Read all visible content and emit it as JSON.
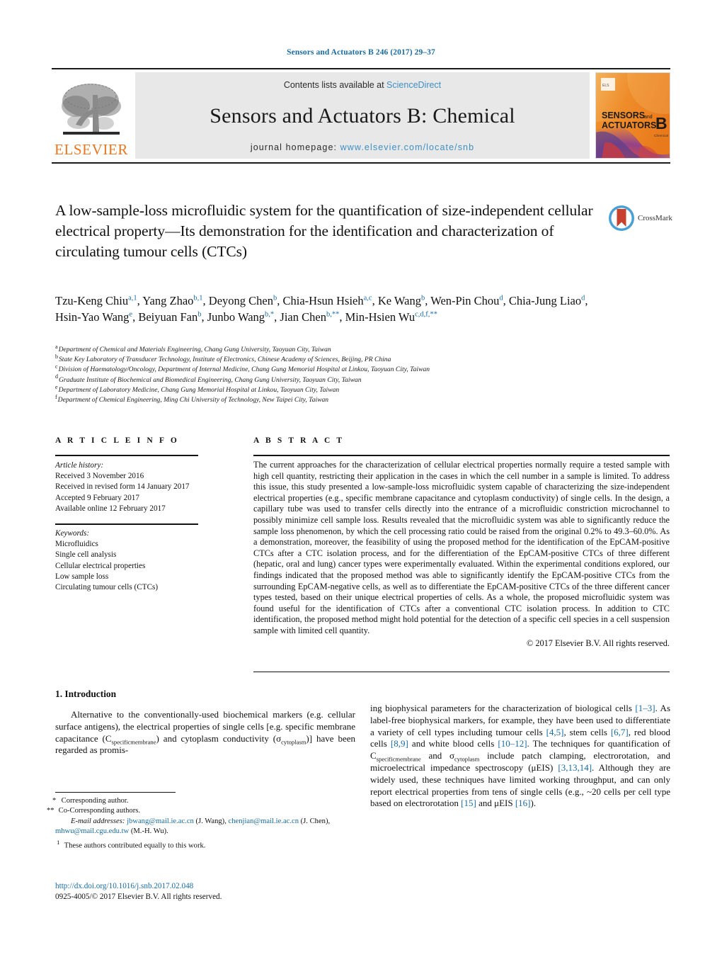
{
  "running_head": "Sensors and Actuators B 246 (2017) 29–37",
  "masthead": {
    "contents_prefix": "Contents lists available at ",
    "sciencedirect": "ScienceDirect",
    "journal_title": "Sensors and Actuators B: Chemical",
    "homepage_prefix": "journal homepage: ",
    "homepage_url": "www.elsevier.com/locate/snb",
    "publisher_wordmark": "ELSEVIER",
    "cover_line1": "SENSORS",
    "cover_and": "and",
    "cover_line2": "ACTUATORS",
    "cover_letter": "B",
    "cover_sub": "Chemical"
  },
  "crossmark": {
    "label": "CrossMark"
  },
  "title": {
    "line1": "A low-sample-loss microfluidic system for the quantification of",
    "line2": "size-independent cellular electrical property—Its demonstration for",
    "line3": "the identification and characterization of circulating tumour cells",
    "line4": "(CTCs)"
  },
  "authors": [
    {
      "name": "Tzu-Keng Chiu",
      "sup": "a,1",
      "sep": ", "
    },
    {
      "name": "Yang Zhao",
      "sup": "b,1",
      "sep": ", "
    },
    {
      "name": "Deyong Chen",
      "sup": "b",
      "sep": ", "
    },
    {
      "name": "Chia-Hsun Hsieh",
      "sup": "a,c",
      "sep": ", "
    },
    {
      "name": "Ke Wang",
      "sup": "b",
      "sep": ", "
    },
    {
      "name": "Wen-Pin Chou",
      "sup": "d",
      "sep": ", "
    },
    {
      "name": "Chia-Jung Liao",
      "sup": "d",
      "sep": ", "
    },
    {
      "name": "Hsin-Yao Wang",
      "sup": "e",
      "sep": ", "
    },
    {
      "name": "Beiyuan Fan",
      "sup": "b",
      "sep": ", "
    },
    {
      "name": "Junbo Wang",
      "sup": "b,*",
      "sep": ", "
    },
    {
      "name": "Jian Chen",
      "sup": "b,**",
      "sep": ", "
    },
    {
      "name": "Min-Hsien Wu",
      "sup": "c,d,f,**",
      "sep": ""
    }
  ],
  "affiliations": [
    {
      "mark": "a",
      "text": "Department of Chemical and Materials Engineering, Chang Gung University, Taoyuan City, Taiwan"
    },
    {
      "mark": "b",
      "text": "State Key Laboratory of Transducer Technology, Institute of Electronics, Chinese Academy of Sciences, Beijing, PR China"
    },
    {
      "mark": "c",
      "text": "Division of Haematology/Oncology, Department of Internal Medicine, Chang Gung Memorial Hospital at Linkou, Taoyuan City, Taiwan"
    },
    {
      "mark": "d",
      "text": "Graduate Institute of Biochemical and Biomedical Engineering, Chang Gung University, Taoyuan City, Taiwan"
    },
    {
      "mark": "e",
      "text": "Department of Laboratory Medicine, Chang Gung Memorial Hospital at Linkou, Taoyuan City, Taiwan"
    },
    {
      "mark": "f",
      "text": "Department of Chemical Engineering, Ming Chi University of Technology, New Taipei City, Taiwan"
    }
  ],
  "article_info": {
    "heading": "A R T I C L E   I N F O",
    "history_label": "Article history:",
    "history": [
      "Received 3 November 2016",
      "Received in revised form 14 January 2017",
      "Accepted 9 February 2017",
      "Available online 12 February 2017"
    ],
    "keywords_label": "Keywords:",
    "keywords": [
      "Microfluidics",
      "Single cell analysis",
      "Cellular electrical properties",
      "Low sample loss",
      "Circulating tumour cells (CTCs)"
    ]
  },
  "abstract": {
    "heading": "A B S T R A C T",
    "text": "The current approaches for the characterization of cellular electrical properties normally require a tested sample with high cell quantity, restricting their application in the cases in which the cell number in a sample is limited. To address this issue, this study presented a low-sample-loss microfluidic system capable of characterizing the size-independent electrical properties (e.g., specific membrane capacitance and cytoplasm conductivity) of single cells. In the design, a capillary tube was used to transfer cells directly into the entrance of a microfluidic constriction microchannel to possibly minimize cell sample loss. Results revealed that the microfluidic system was able to significantly reduce the sample loss phenomenon, by which the cell processing ratio could be raised from the original 0.2% to 49.3–60.0%. As a demonstration, moreover, the feasibility of using the proposed method for the identification of the EpCAM-positive CTCs after a CTC isolation process, and for the differentiation of the EpCAM-positive CTCs of three different (hepatic, oral and lung) cancer types were experimentally evaluated. Within the experimental conditions explored, our findings indicated that the proposed method was able to significantly identify the EpCAM-positive CTCs from the surrounding EpCAM-negative cells, as well as to differentiate the EpCAM-positive CTCs of the three different cancer types tested, based on their unique electrical properties of cells. As a whole, the proposed microfluidic system was found useful for the identification of CTCs after a conventional CTC isolation process. In addition to CTC identification, the proposed method might hold potential for the detection of a specific cell species in a cell suspension sample with limited cell quantity.",
    "copyright": "© 2017 Elsevier B.V. All rights reserved."
  },
  "introduction": {
    "heading": "1.  Introduction",
    "left_para_a": "Alternative to the conventionally-used biochemical markers (e.g. cellular surface antigens), the electrical properties of single cells [e.g. specific membrane capacitance (C",
    "left_sub_1": "specificmembrane",
    "left_para_b": ") and cytoplasm conductivity (σ",
    "left_sub_2": "cytoplasm",
    "left_para_c": ")] have been regarded as promis-",
    "right_part_a": "ing biophysical parameters for the characterization of biological cells ",
    "right_ref_1": "[1–3]",
    "right_part_b": ". As label-free biophysical markers, for example, they have been used to differentiate a variety of cell types including tumour cells ",
    "right_ref_2": "[4,5]",
    "right_part_c": ", stem cells ",
    "right_ref_3": "[6,7]",
    "right_part_d": ", red blood cells ",
    "right_ref_4": "[8,9]",
    "right_part_e": " and white blood cells ",
    "right_ref_5": "[10–12]",
    "right_part_f": ". The techniques for quantification of C",
    "right_sub_1": "specificmembrane",
    "right_part_g": " and σ",
    "right_sub_2": "cytoplasm",
    "right_part_h": " include patch clamping, electrorotation, and microelectrical impedance spectroscopy (μEIS) ",
    "right_ref_6": "[3,13,14]",
    "right_part_i": ". Although they are widely used, these techniques have limited working throughput, and can only report electrical properties from tens of single cells (e.g., ~20 cells per cell type based on electrorotation ",
    "right_ref_7": "[15]",
    "right_part_j": " and μEIS ",
    "right_ref_8": "[16]",
    "right_part_k": ")."
  },
  "footnotes": {
    "corresponding": "Corresponding author.",
    "corresponding_mark": "*",
    "co_corresponding": "Co-Corresponding authors.",
    "co_corresponding_mark": "**",
    "email_label": "E-mail addresses:",
    "email1": "jbwang@mail.ie.ac.cn",
    "email1_owner": "(J. Wang),",
    "email2": "chenjian@mail.ie.ac.cn",
    "email2_owner": "(J. Chen),",
    "email3": "mhwu@mail.cgu.edu.tw",
    "email3_owner": "(M.-H. Wu).",
    "equal_mark": "1",
    "equal_contrib": "These authors contributed equally to this work."
  },
  "doi_block": {
    "doi": "http://dx.doi.org/10.1016/j.snb.2017.02.048",
    "issn_line": "0925-4005/© 2017 Elsevier B.V. All rights reserved."
  },
  "colors": {
    "link_blue": "#1a6ba0",
    "sciencedirect_blue": "#3f8fc4",
    "elsevier_orange": "#e87722",
    "band_gray": "#e8e8e8"
  }
}
